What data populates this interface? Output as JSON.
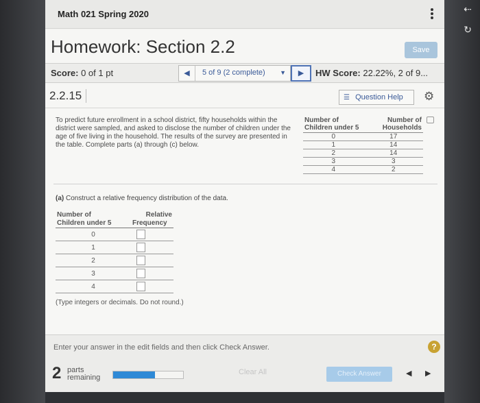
{
  "app": {
    "title": "Math 021 Spring 2020"
  },
  "header": {
    "title": "Homework: Section 2.2",
    "save_label": "Save"
  },
  "score": {
    "label": "Score:",
    "value": "0 of 1 pt"
  },
  "question_nav": {
    "prev": "◀",
    "position": "5 of 9 (2 complete)",
    "dropdown": "▼",
    "next": "▶"
  },
  "hw_score": {
    "label": "HW Score:",
    "value": "22.22%, 2 of 9..."
  },
  "question": {
    "number": "2.2.15",
    "help_label": "Question Help"
  },
  "problem_text": "To predict future enrollment in a school district, fifty households within the district were sampled, and asked to disclose the number of children under the age of five living in the household. The results of the survey are presented in the table. Complete parts (a) through (c) below.",
  "data_table": {
    "col1_header": "Number of Children under 5",
    "col2_header": "Number of Households",
    "rows": [
      {
        "children": "0",
        "households": "17"
      },
      {
        "children": "1",
        "households": "14"
      },
      {
        "children": "2",
        "households": "14"
      },
      {
        "children": "3",
        "households": "3"
      },
      {
        "children": "4",
        "households": "2"
      }
    ]
  },
  "part_a": {
    "label": "(a)",
    "text": "Construct a relative frequency distribution of the data.",
    "col1_line1": "Number of",
    "col1_line2": "Children under 5",
    "col2_line1": "Relative",
    "col2_line2": "Frequency",
    "values": [
      "0",
      "1",
      "2",
      "3",
      "4"
    ],
    "hint": "(Type integers or decimals. Do not round.)"
  },
  "footer": {
    "instruction": "Enter your answer in the edit fields and then click Check Answer.",
    "help": "?",
    "parts_count": "2",
    "parts_line1": "parts",
    "parts_line2": "remaining",
    "progress_fraction": 0.6,
    "clear_label": "Clear All",
    "check_label": "Check Answer",
    "prev": "◀",
    "next": "▶"
  },
  "colors": {
    "accent": "#2e89d6",
    "link": "#3a5a98",
    "help_badge": "#c8a232"
  }
}
